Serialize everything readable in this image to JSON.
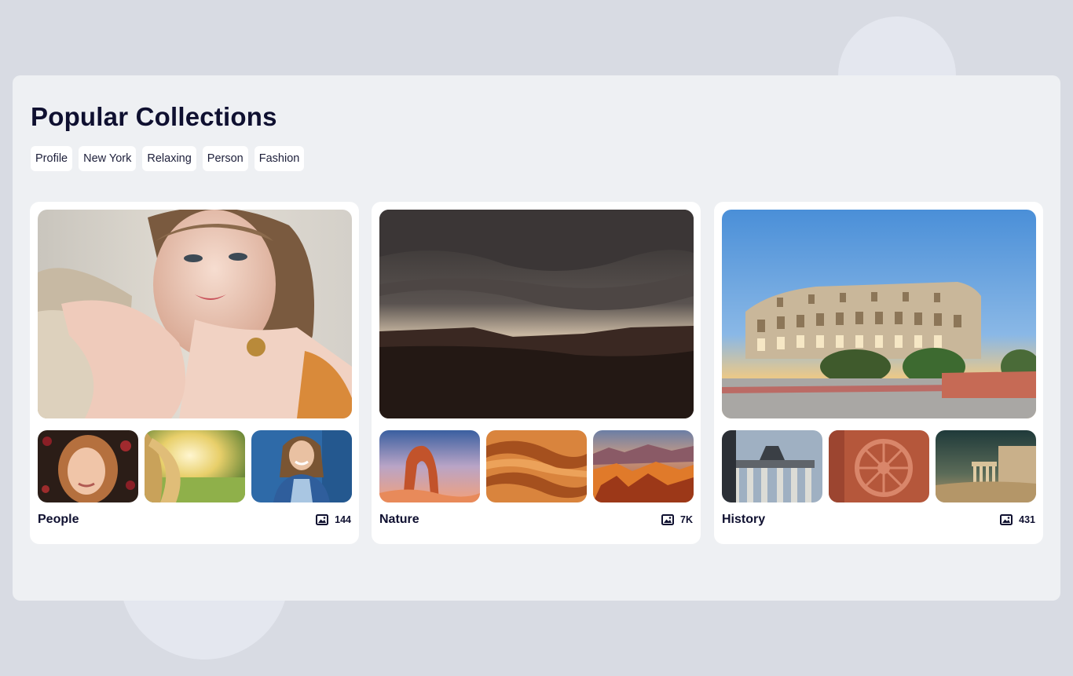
{
  "page": {
    "title": "Popular Collections",
    "tags": [
      "Profile",
      "New York",
      "Relaxing",
      "Person",
      "Fashion"
    ]
  },
  "collections": [
    {
      "name": "People",
      "count": "144",
      "main_image": "woman-portrait-earrings",
      "thumbnails": [
        "woman-lying-flowers",
        "woman-hair-sunset",
        "woman-denim-jacket"
      ]
    },
    {
      "name": "Nature",
      "count": "7K",
      "main_image": "stormy-desert-landscape",
      "thumbnails": [
        "delicate-arch",
        "sand-dunes",
        "canyon-sunset"
      ]
    },
    {
      "name": "History",
      "count": "431",
      "main_image": "colosseum",
      "thumbnails": [
        "brandenburg-gate",
        "konark-wheel",
        "erechtheion"
      ]
    }
  ],
  "icons": {
    "count_icon": "image-icon"
  },
  "colors": {
    "background": "#d8dbe3",
    "panel": "#eef0f3",
    "card": "#ffffff",
    "text": "#0f1030"
  }
}
